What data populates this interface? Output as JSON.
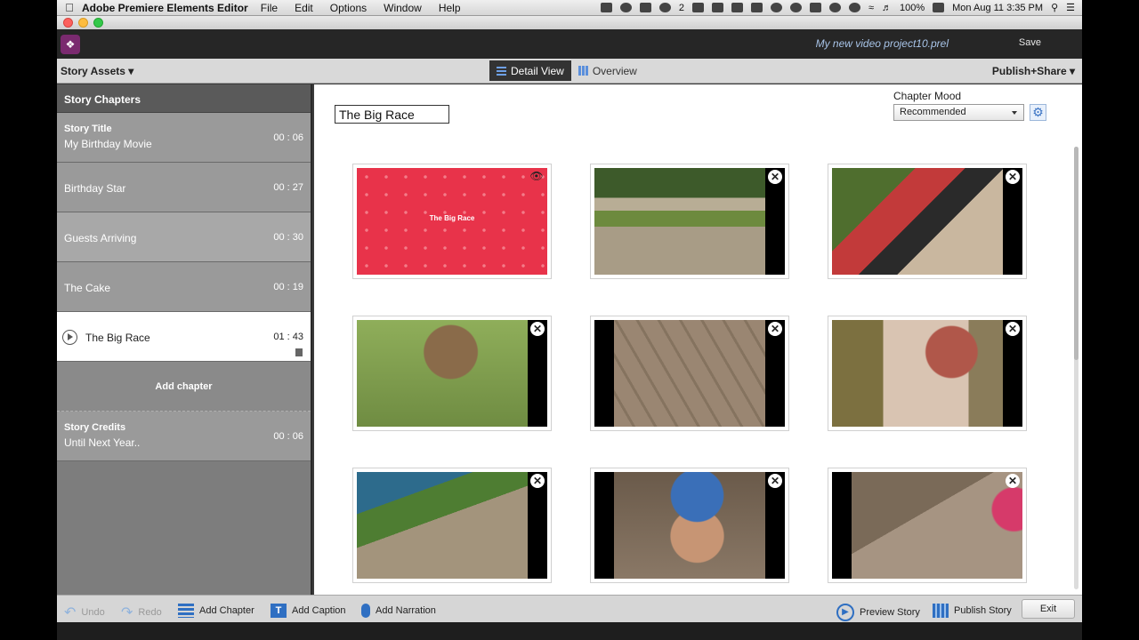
{
  "menubar": {
    "app_name": "Adobe Premiere Elements Editor",
    "menus": [
      "File",
      "Edit",
      "Options",
      "Window",
      "Help"
    ],
    "battery": "100%",
    "clock": "Mon Aug 11  3:35 PM",
    "badge_count": "2"
  },
  "header": {
    "project_name": "My new video project10.prel",
    "save_label": "Save"
  },
  "toolbar": {
    "story_assets_label": "Story Assets",
    "detail_view_label": "Detail View",
    "overview_label": "Overview",
    "publish_share_label": "Publish+Share"
  },
  "sidebar": {
    "heading": "Story Chapters",
    "story_title": {
      "label": "Story Title",
      "value": "My Birthday Movie",
      "duration": "00 : 06"
    },
    "chapters": [
      {
        "name": "Birthday Star",
        "duration": "00 : 27"
      },
      {
        "name": "Guests Arriving",
        "duration": "00 : 30"
      },
      {
        "name": "The Cake",
        "duration": "00 : 19"
      },
      {
        "name": "The Big Race",
        "duration": "01 : 43"
      }
    ],
    "add_chapter_label": "Add chapter",
    "credits": {
      "label": "Story Credits",
      "value": "Until Next Year..",
      "duration": "00 : 06"
    }
  },
  "main": {
    "chapter_title_value": "The Big Race",
    "mood_label": "Chapter Mood",
    "mood_selected": "Recommended",
    "title_card_text": "The Big Race"
  },
  "bottom": {
    "undo_label": "Undo",
    "redo_label": "Redo",
    "add_chapter_label": "Add Chapter",
    "add_caption_label": "Add Caption",
    "add_narration_label": "Add Narration",
    "preview_story_label": "Preview Story",
    "publish_story_label": "Publish Story",
    "exit_label": "Exit"
  },
  "colors": {
    "title_card_red": "#e8334a",
    "accent_blue": "#3b74c4",
    "project_name_blue": "#a8c4e8"
  }
}
